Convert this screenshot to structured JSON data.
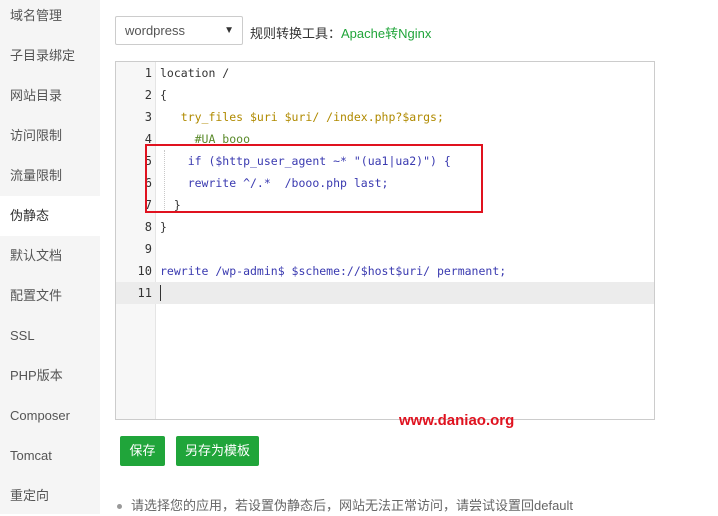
{
  "sidebar": {
    "items": [
      {
        "label": "域名管理"
      },
      {
        "label": "子目录绑定"
      },
      {
        "label": "网站目录"
      },
      {
        "label": "访问限制"
      },
      {
        "label": "流量限制"
      },
      {
        "label": "伪静态"
      },
      {
        "label": "默认文档"
      },
      {
        "label": "配置文件"
      },
      {
        "label": "SSL"
      },
      {
        "label": "PHP版本"
      },
      {
        "label": "Composer"
      },
      {
        "label": "Tomcat"
      },
      {
        "label": "重定向"
      }
    ],
    "active_label": "伪静态"
  },
  "rewrite_select": {
    "value": "wordpress"
  },
  "rule_tool": {
    "label": "规则转换工具：",
    "link": "Apache转Nginx"
  },
  "editor": {
    "line_numbers": [
      "1",
      "2",
      "3",
      "4",
      "5",
      "6",
      "7",
      "8",
      "9",
      "10",
      "11"
    ],
    "lines": [
      "location /",
      "{",
      "   try_files $uri $uri/ /index.php?$args;",
      "     #UA booo",
      "    if ($http_user_agent ~* \"(ua1|ua2)\") {",
      "    rewrite ^/.*  /booo.php last;",
      "  }",
      "}",
      "",
      "rewrite /wp-admin$ $scheme://$host$uri/ permanent;",
      ""
    ],
    "active_line": "11"
  },
  "watermark": "www.daniao.org",
  "buttons": {
    "save": "保存",
    "save_as_template": "另存为模板"
  },
  "tip": "请选择您的应用，若设置伪静态后，网站无法正常访问，请尝试设置回default",
  "colors": {
    "accent": "#20a53a",
    "highlight": "#e0121f"
  }
}
